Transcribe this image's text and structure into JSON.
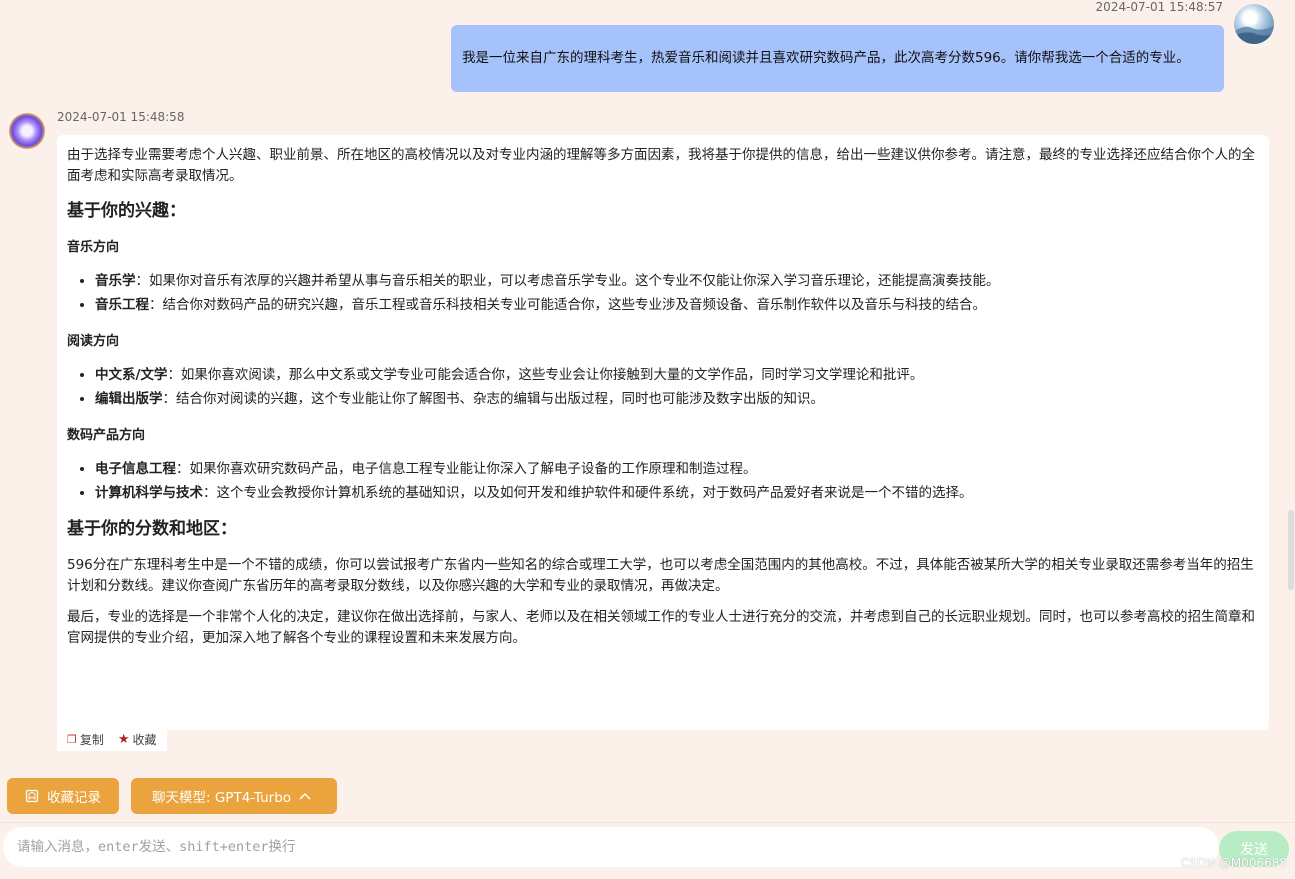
{
  "user_message": {
    "timestamp": "2024-07-01 15:48:57",
    "text": "我是一位来自广东的理科考生，热爱音乐和阅读并且喜欢研究数码产品，此次高考分数596。请你帮我选一个合适的专业。"
  },
  "bot_message": {
    "timestamp": "2024-07-01 15:48:58",
    "intro": "由于选择专业需要考虑个人兴趣、职业前景、所在地区的高校情况以及对专业内涵的理解等多方面因素，我将基于你提供的信息，给出一些建议供你参考。请注意，最终的专业选择还应结合你个人的全面考虑和实际高考录取情况。",
    "section1_title": "基于你的兴趣：",
    "groups": [
      {
        "title": "音乐方向",
        "items": [
          {
            "term": "音乐学",
            "desc": "：如果你对音乐有浓厚的兴趣并希望从事与音乐相关的职业，可以考虑音乐学专业。这个专业不仅能让你深入学习音乐理论，还能提高演奏技能。"
          },
          {
            "term": "音乐工程",
            "desc": "：结合你对数码产品的研究兴趣，音乐工程或音乐科技相关专业可能适合你，这些专业涉及音频设备、音乐制作软件以及音乐与科技的结合。"
          }
        ]
      },
      {
        "title": "阅读方向",
        "items": [
          {
            "term": "中文系/文学",
            "desc": "：如果你喜欢阅读，那么中文系或文学专业可能会适合你，这些专业会让你接触到大量的文学作品，同时学习文学理论和批评。"
          },
          {
            "term": "编辑出版学",
            "desc": "：结合你对阅读的兴趣，这个专业能让你了解图书、杂志的编辑与出版过程，同时也可能涉及数字出版的知识。"
          }
        ]
      },
      {
        "title": "数码产品方向",
        "items": [
          {
            "term": "电子信息工程",
            "desc": "：如果你喜欢研究数码产品，电子信息工程专业能让你深入了解电子设备的工作原理和制造过程。"
          },
          {
            "term": "计算机科学与技术",
            "desc": "：这个专业会教授你计算机系统的基础知识，以及如何开发和维护软件和硬件系统，对于数码产品爱好者来说是一个不错的选择。"
          }
        ]
      }
    ],
    "section2_title": "基于你的分数和地区：",
    "para1": "596分在广东理科考生中是一个不错的成绩，你可以尝试报考广东省内一些知名的综合或理工大学，也可以考虑全国范围内的其他高校。不过，具体能否被某所大学的相关专业录取还需参考当年的招生计划和分数线。建议你查阅广东省历年的高考录取分数线，以及你感兴趣的大学和专业的录取情况，再做决定。",
    "para2": "最后，专业的选择是一个非常个人化的决定，建议你在做出选择前，与家人、老师以及在相关领域工作的专业人士进行充分的交流，并考虑到自己的长远职业规划。同时，也可以参考高校的招生简章和官网提供的专业介绍，更加深入地了解各个专业的课程设置和未来发展方向。"
  },
  "actions": {
    "copy_label": "复制",
    "favorite_label": "收藏"
  },
  "toolbar": {
    "favorites_label": "收藏记录",
    "model_label": "聊天模型: GPT4-Turbo"
  },
  "input": {
    "placeholder": "请输入消息，enter发送、shift+enter换行",
    "send_label": "发送"
  },
  "watermark": "CSDN @M006688"
}
